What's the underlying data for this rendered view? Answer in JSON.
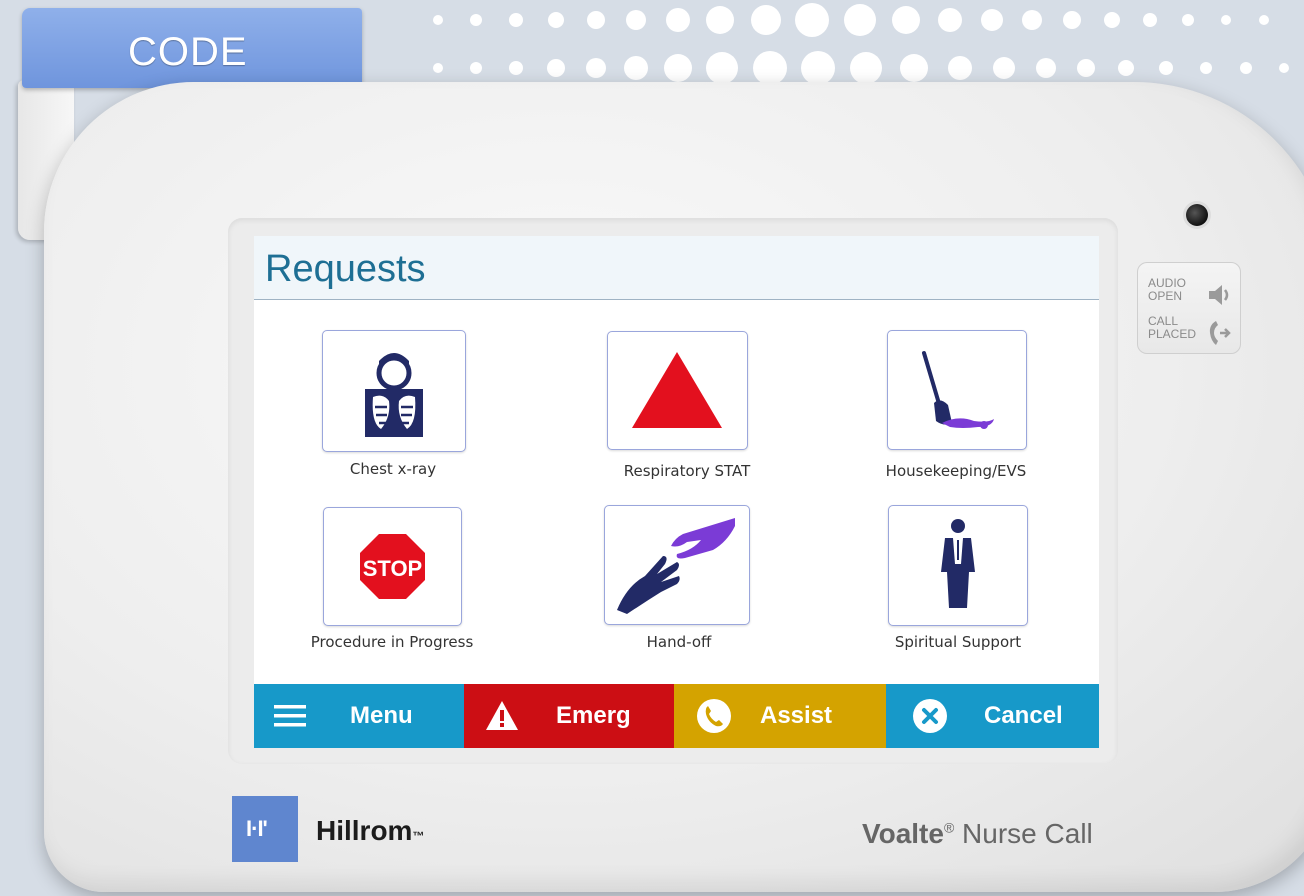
{
  "code_tab": {
    "label": "CODE"
  },
  "indicators": {
    "audio_open_line1": "AUDIO",
    "audio_open_line2": "OPEN",
    "call_placed_line1": "CALL",
    "call_placed_line2": "PLACED"
  },
  "screen": {
    "title": "Requests",
    "tiles": [
      {
        "label": "Chest x-ray",
        "icon": "chest-xray-icon"
      },
      {
        "label": "Respiratory STAT",
        "icon": "red-triangle-icon"
      },
      {
        "label": "Housekeeping/EVS",
        "icon": "mop-icon"
      },
      {
        "label": "Procedure in Progress",
        "icon": "stop-sign-icon",
        "sign_text": "STOP"
      },
      {
        "label": "Hand-off",
        "icon": "hands-icon"
      },
      {
        "label": "Spiritual Support",
        "icon": "person-icon"
      }
    ],
    "buttons": [
      {
        "label": "Menu",
        "color": "#1799c9",
        "icon": "menu-icon"
      },
      {
        "label": "Emerg",
        "color": "#cc0e14",
        "icon": "warning-icon"
      },
      {
        "label": "Assist",
        "color": "#d4a300",
        "icon": "phone-icon"
      },
      {
        "label": "Cancel",
        "color": "#1799c9",
        "icon": "cancel-icon"
      }
    ]
  },
  "branding": {
    "logo_mark": "I·I'",
    "company": "Hillrom",
    "company_tm": "™",
    "product_bold": "Voalte",
    "product_reg": "®",
    "product_rest": " Nurse Call"
  }
}
